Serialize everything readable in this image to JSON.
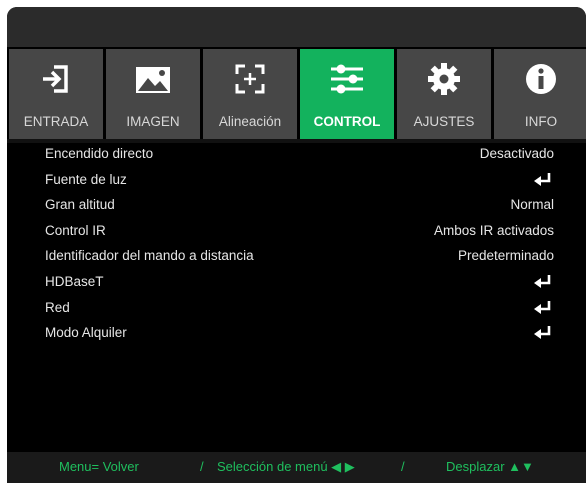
{
  "tabs": [
    {
      "label": "ENTRADA",
      "icon": "input-icon",
      "active": false
    },
    {
      "label": "IMAGEN",
      "icon": "image-icon",
      "active": false
    },
    {
      "label": "Alineación",
      "icon": "alignment-icon",
      "active": false
    },
    {
      "label": "CONTROL",
      "icon": "sliders-icon",
      "active": true
    },
    {
      "label": "AJUSTES",
      "icon": "gear-icon",
      "active": false
    },
    {
      "label": "INFO",
      "icon": "info-icon",
      "active": false
    }
  ],
  "menu": [
    {
      "label": "Encendido directo",
      "value": "Desactivado"
    },
    {
      "label": "Fuente de luz",
      "value": null,
      "icon": "enter-icon"
    },
    {
      "label": "Gran altitud",
      "value": "Normal"
    },
    {
      "label": "Control IR",
      "value": "Ambos IR activados"
    },
    {
      "label": "Identificador del mando a distancia",
      "value": "Predeterminado"
    },
    {
      "label": "HDBaseT",
      "value": null,
      "icon": "enter-icon"
    },
    {
      "label": "Red",
      "value": null,
      "icon": "enter-icon"
    },
    {
      "label": "Modo Alquiler",
      "value": null,
      "icon": "enter-icon"
    }
  ],
  "footer": {
    "back": "Menu= Volver",
    "sep1": "/",
    "select": "Selección de menú ◀ ▶",
    "sep2": "/",
    "scroll": "Desplazar ▲▼"
  },
  "colors": {
    "accent": "#13b25d",
    "tab_bg": "#474747",
    "footer_text": "#1fbf5e"
  }
}
